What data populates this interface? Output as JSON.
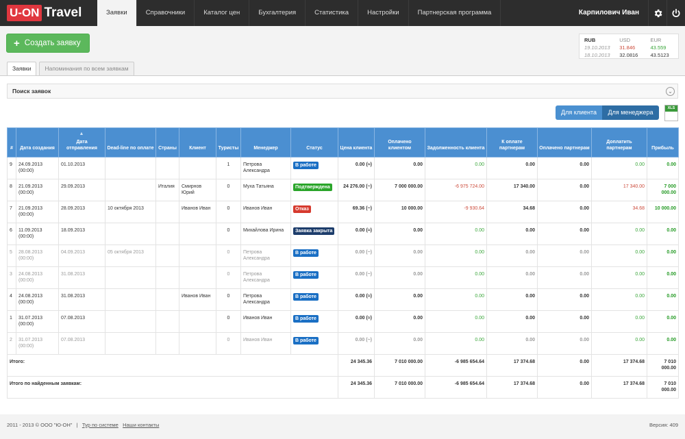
{
  "app": {
    "logo_brand": "U-ON",
    "logo_suffix": "Travel",
    "user": "Карпилович Иван"
  },
  "nav": [
    "Заявки",
    "Справочники",
    "Каталог цен",
    "Бухгалтерия",
    "Статистика",
    "Настройки",
    "Партнерская программа"
  ],
  "create_button": "Создать заявку",
  "rates": {
    "head": [
      "RUB",
      "USD",
      "EUR"
    ],
    "rows": [
      [
        "19.10.2013",
        "31.846",
        "43.559"
      ],
      [
        "18.10.2013",
        "32.0816",
        "43.5123"
      ]
    ]
  },
  "tabs": [
    "Заявки",
    "Напоминания по всем заявкам"
  ],
  "search_label": "Поиск заявок",
  "view_buttons": {
    "client": "Для клиента",
    "manager": "Для менеджера"
  },
  "xls_label": "XLS",
  "table": {
    "headers": [
      "#",
      "Дата создания",
      "Дата отправления",
      "Dead-line по оплате",
      "Страны",
      "Клиент",
      "Туристы",
      "Менеджер",
      "Статус",
      "Цена клиента",
      "Оплачено клиентом",
      "Задолженность клиента",
      "К оплате партнерам",
      "Оплачено партнерам",
      "Доплатить партнерам",
      "Прибыль"
    ],
    "rows": [
      {
        "id": "9",
        "created": "24.09.2013 (00:00)",
        "departure": "01.10.2013",
        "deadline": "",
        "countries": "",
        "client": "",
        "tourists": "1",
        "manager": "Петрова Александра",
        "status": "В работе",
        "price": "0.00 (≈)",
        "paid": "0.00",
        "debt": "0.00",
        "to_pay": "0.00",
        "paid_partner": "0.00",
        "surcharge": "0.00",
        "profit": "0.00",
        "gray": false
      },
      {
        "id": "8",
        "created": "21.09.2013 (00:00)",
        "departure": "29.09.2013",
        "deadline": "",
        "countries": "Италия",
        "client": "Смирнов Юрий",
        "tourists": "0",
        "manager": "Муха Татьяна",
        "status": "Подтверждена",
        "price": "24 276.00 (~)",
        "paid": "7 000 000.00",
        "debt": "-6 975 724.00",
        "to_pay": "17 340.00",
        "paid_partner": "0.00",
        "surcharge": "17 340.00",
        "profit": "7 000 000.00",
        "gray": false
      },
      {
        "id": "7",
        "created": "21.09.2013 (00:00)",
        "departure": "28.09.2013",
        "deadline": "10 октября 2013",
        "countries": "",
        "client": "Иванов Иван",
        "tourists": "0",
        "manager": "Иванов Иван",
        "status": "Отказ",
        "price": "69.36 (~)",
        "paid": "10 000.00",
        "debt": "-9 930.64",
        "to_pay": "34.68",
        "paid_partner": "0.00",
        "surcharge": "34.68",
        "profit": "10 000.00",
        "gray": false
      },
      {
        "id": "6",
        "created": "11.09.2013 (00:00)",
        "departure": "18.09.2013",
        "deadline": "",
        "countries": "",
        "client": "",
        "tourists": "0",
        "manager": "Михайлова Ирина",
        "status": "Заявка закрыта",
        "price": "0.00 (≈)",
        "paid": "0.00",
        "debt": "0.00",
        "to_pay": "0.00",
        "paid_partner": "0.00",
        "surcharge": "0.00",
        "profit": "0.00",
        "gray": false
      },
      {
        "id": "5",
        "created": "28.08.2013 (00:00)",
        "departure": "04.09.2013",
        "deadline": "05 октября 2013",
        "countries": "",
        "client": "",
        "tourists": "0",
        "manager": "Петрова Александра",
        "status": "В работе",
        "price": "0.00 (~)",
        "paid": "0.00",
        "debt": "0.00",
        "to_pay": "0.00",
        "paid_partner": "0.00",
        "surcharge": "0.00",
        "profit": "0.00",
        "gray": true
      },
      {
        "id": "3",
        "created": "24.08.2013 (00:00)",
        "departure": "31.08.2013",
        "deadline": "",
        "countries": "",
        "client": "",
        "tourists": "0",
        "manager": "Петрова Александра",
        "status": "В работе",
        "price": "0.00 (~)",
        "paid": "0.00",
        "debt": "0.00",
        "to_pay": "0.00",
        "paid_partner": "0.00",
        "surcharge": "0.00",
        "profit": "0.00",
        "gray": true
      },
      {
        "id": "4",
        "created": "24.08.2013 (00:00)",
        "departure": "31.08.2013",
        "deadline": "",
        "countries": "",
        "client": "Иванов Иван",
        "tourists": "0",
        "manager": "Петрова Александра",
        "status": "В работе",
        "price": "0.00 (≈)",
        "paid": "0.00",
        "debt": "0.00",
        "to_pay": "0.00",
        "paid_partner": "0.00",
        "surcharge": "0.00",
        "profit": "0.00",
        "gray": false
      },
      {
        "id": "1",
        "created": "31.07.2013 (00:00)",
        "departure": "07.08.2013",
        "deadline": "",
        "countries": "",
        "client": "",
        "tourists": "0",
        "manager": "Иванов Иван",
        "status": "В работе",
        "price": "0.00 (≈)",
        "paid": "0.00",
        "debt": "0.00",
        "to_pay": "0.00",
        "paid_partner": "0.00",
        "surcharge": "0.00",
        "profit": "0.00",
        "gray": false
      },
      {
        "id": "2",
        "created": "31.07.2013 (00:00)",
        "departure": "07.08.2013",
        "deadline": "",
        "countries": "",
        "client": "",
        "tourists": "0",
        "manager": "Иванов Иван",
        "status": "В работе",
        "price": "0.00 (~)",
        "paid": "0.00",
        "debt": "0.00",
        "to_pay": "0.00",
        "paid_partner": "0.00",
        "surcharge": "0.00",
        "profit": "0.00",
        "gray": true
      }
    ],
    "totals": [
      {
        "label": "Итого:",
        "price": "24 345.36",
        "paid": "7 010 000.00",
        "debt": "-6 985 654.64",
        "to_pay": "17 374.68",
        "paid_partner": "0.00",
        "surcharge": "17 374.68",
        "profit": "7 010 000.00"
      },
      {
        "label": "Итого по найденным заявкам:",
        "price": "24 345.36",
        "paid": "7 010 000.00",
        "debt": "-6 985 654.64",
        "to_pay": "17 374.68",
        "paid_partner": "0.00",
        "surcharge": "17 374.68",
        "profit": "7 010 000.00"
      }
    ]
  },
  "status_colors": {
    "В работе": "#1a6fc4",
    "Подтверждена": "#2aa52a",
    "Отказ": "#d63a2e",
    "Заявка закрыта": "#1d3d6b"
  },
  "footer": {
    "copyright": "2011 - 2013 © ООО \"Ю-ОН\"",
    "separator": "|",
    "tour": "Тур по системе",
    "contacts": "Наши контакты",
    "version": "Версия: 409"
  }
}
